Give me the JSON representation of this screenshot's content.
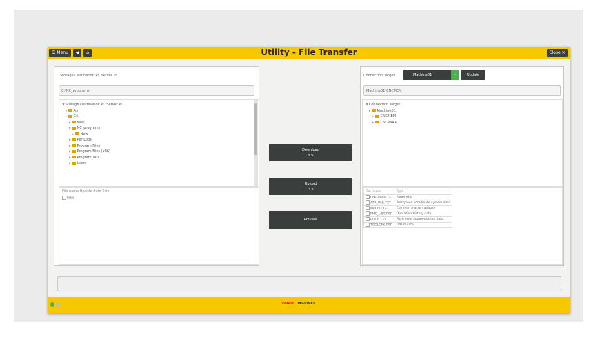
{
  "header": {
    "title": "Utility - File Transfer",
    "menu_label": "Menu",
    "right_button_label": "Close",
    "icons": [
      "menu-icon",
      "back-icon",
      "home-icon"
    ]
  },
  "left": {
    "heading": "Storage Destination PC Server PC",
    "path": "C:\\NC_programs",
    "tree": [
      {
        "label": "Storage Destination PC Server PC",
        "indent": 0
      },
      {
        "label": "A:\\",
        "indent": 1
      },
      {
        "label": "C:\\",
        "indent": 1
      },
      {
        "label": "Intel",
        "indent": 2
      },
      {
        "label": "NC_programs",
        "indent": 2
      },
      {
        "label": "New",
        "indent": 3
      },
      {
        "label": "PerfLogs",
        "indent": 2
      },
      {
        "label": "Program Files",
        "indent": 2
      },
      {
        "label": "Program Files (x86)",
        "indent": 2
      },
      {
        "label": "ProgramData",
        "indent": 2
      },
      {
        "label": "Users",
        "indent": 2
      }
    ],
    "file_header": "File name  Update date  Size",
    "files": [
      "New"
    ]
  },
  "right": {
    "connection_label": "Connection Target",
    "connection_value": "Machine01",
    "update_label": "Update",
    "path": "Machine01\\CNCMEM",
    "tree": [
      {
        "label": "Connection Target",
        "indent": 0
      },
      {
        "label": "Machine01",
        "indent": 1
      },
      {
        "label": "CNCMEM",
        "indent": 2
      },
      {
        "label": "CNCPARA",
        "indent": 2
      }
    ],
    "table_headers": [
      "File name",
      "Type"
    ],
    "table_rows": [
      [
        "CNC-PARA.TXT",
        "Parameter"
      ],
      [
        "ATR_VAR.TXT",
        "Workpiece coordinate system data"
      ],
      [
        "MACRO.TXT",
        "Common macro variable"
      ],
      [
        "PMC_LIST.TXT",
        "Operation history data"
      ],
      [
        "PITCH.TXT",
        "Pitch error compensation data"
      ],
      [
        "TOOLOFS.TXT",
        "Offset data"
      ]
    ]
  },
  "middle": {
    "download_label": "Download",
    "download_arrow": ">>",
    "upload_label": "Upload",
    "upload_arrow": "<<",
    "preview_label": "Preview"
  },
  "footer": {
    "brand": "FANUC",
    "status": "MT-LINKi",
    "brand_color": "#e60012"
  }
}
